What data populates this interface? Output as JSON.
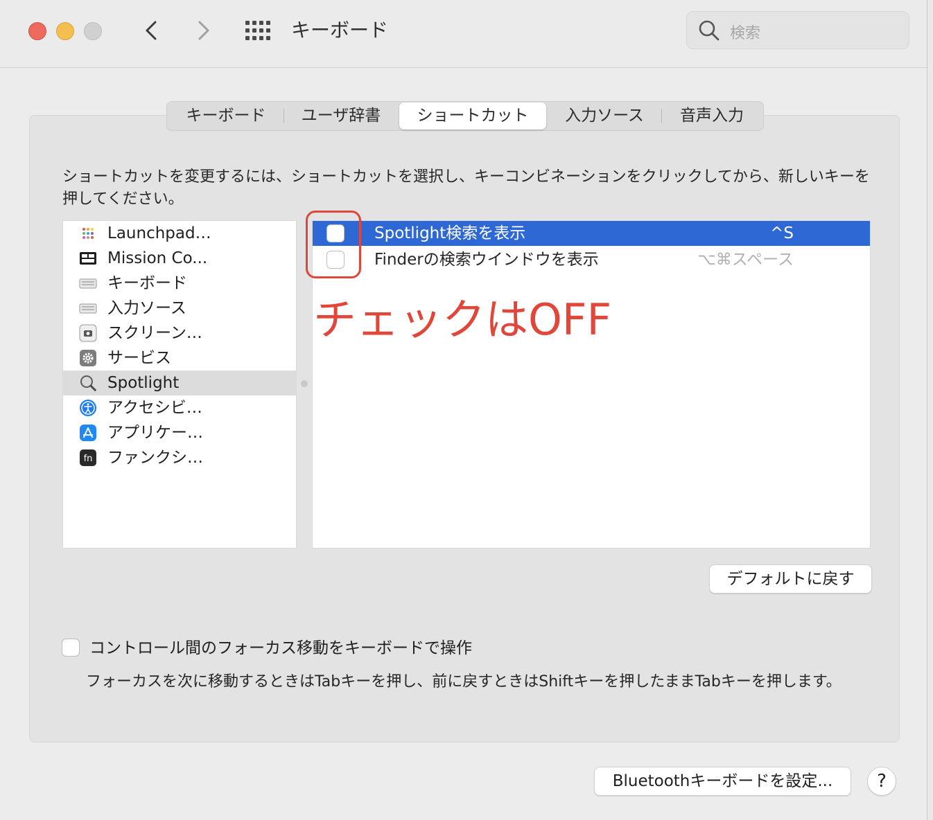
{
  "window": {
    "title": "キーボード",
    "search_placeholder": "検索"
  },
  "tabs": [
    {
      "label": "キーボード",
      "active": false
    },
    {
      "label": "ユーザ辞書",
      "active": false
    },
    {
      "label": "ショートカット",
      "active": true
    },
    {
      "label": "入力ソース",
      "active": false
    },
    {
      "label": "音声入力",
      "active": false
    }
  ],
  "instructions": "ショートカットを変更するには、ショートカットを選択し、キーコンビネーションをクリックしてから、新しいキーを押してください。",
  "categories": [
    {
      "label": "Launchpad…",
      "icon": "launchpad-icon",
      "selected": false
    },
    {
      "label": "Mission Co...",
      "icon": "mission-control-icon",
      "selected": false
    },
    {
      "label": "キーボード",
      "icon": "keyboard-icon",
      "selected": false
    },
    {
      "label": "入力ソース",
      "icon": "input-source-icon",
      "selected": false
    },
    {
      "label": "スクリーン…",
      "icon": "screenshot-icon",
      "selected": false
    },
    {
      "label": "サービス",
      "icon": "gear-icon",
      "selected": false
    },
    {
      "label": "Spotlight",
      "icon": "spotlight-icon",
      "selected": true
    },
    {
      "label": "アクセシビ…",
      "icon": "accessibility-icon",
      "selected": false
    },
    {
      "label": "アプリケー…",
      "icon": "app-store-icon",
      "selected": false
    },
    {
      "label": "ファンクシ…",
      "icon": "fn-key-icon",
      "selected": false
    }
  ],
  "shortcuts": [
    {
      "label": "Spotlight検索を表示",
      "key": "^S",
      "checked": false,
      "selected": true
    },
    {
      "label": "Finderの検索ウインドウを表示",
      "key": "⌥⌘スペース",
      "checked": false,
      "selected": false
    }
  ],
  "annotation": {
    "text": "チェックはOFF",
    "color": "#e0463a"
  },
  "buttons": {
    "restore_defaults": "デフォルトに戻す",
    "bluetooth_setup": "Bluetoothキーボードを設定...",
    "help": "?"
  },
  "keyboard_navigation": {
    "label": "コントロール間のフォーカス移動をキーボードで操作",
    "checked": false,
    "description": "フォーカスを次に移動するときはTabキーを押し、前に戻すときはShiftキーを押したままTabキーを押します。"
  },
  "colors": {
    "selection": "#2e68d5",
    "annotation": "#e0463a",
    "close": "#ed6a5e",
    "minimize": "#f5bf4f"
  }
}
